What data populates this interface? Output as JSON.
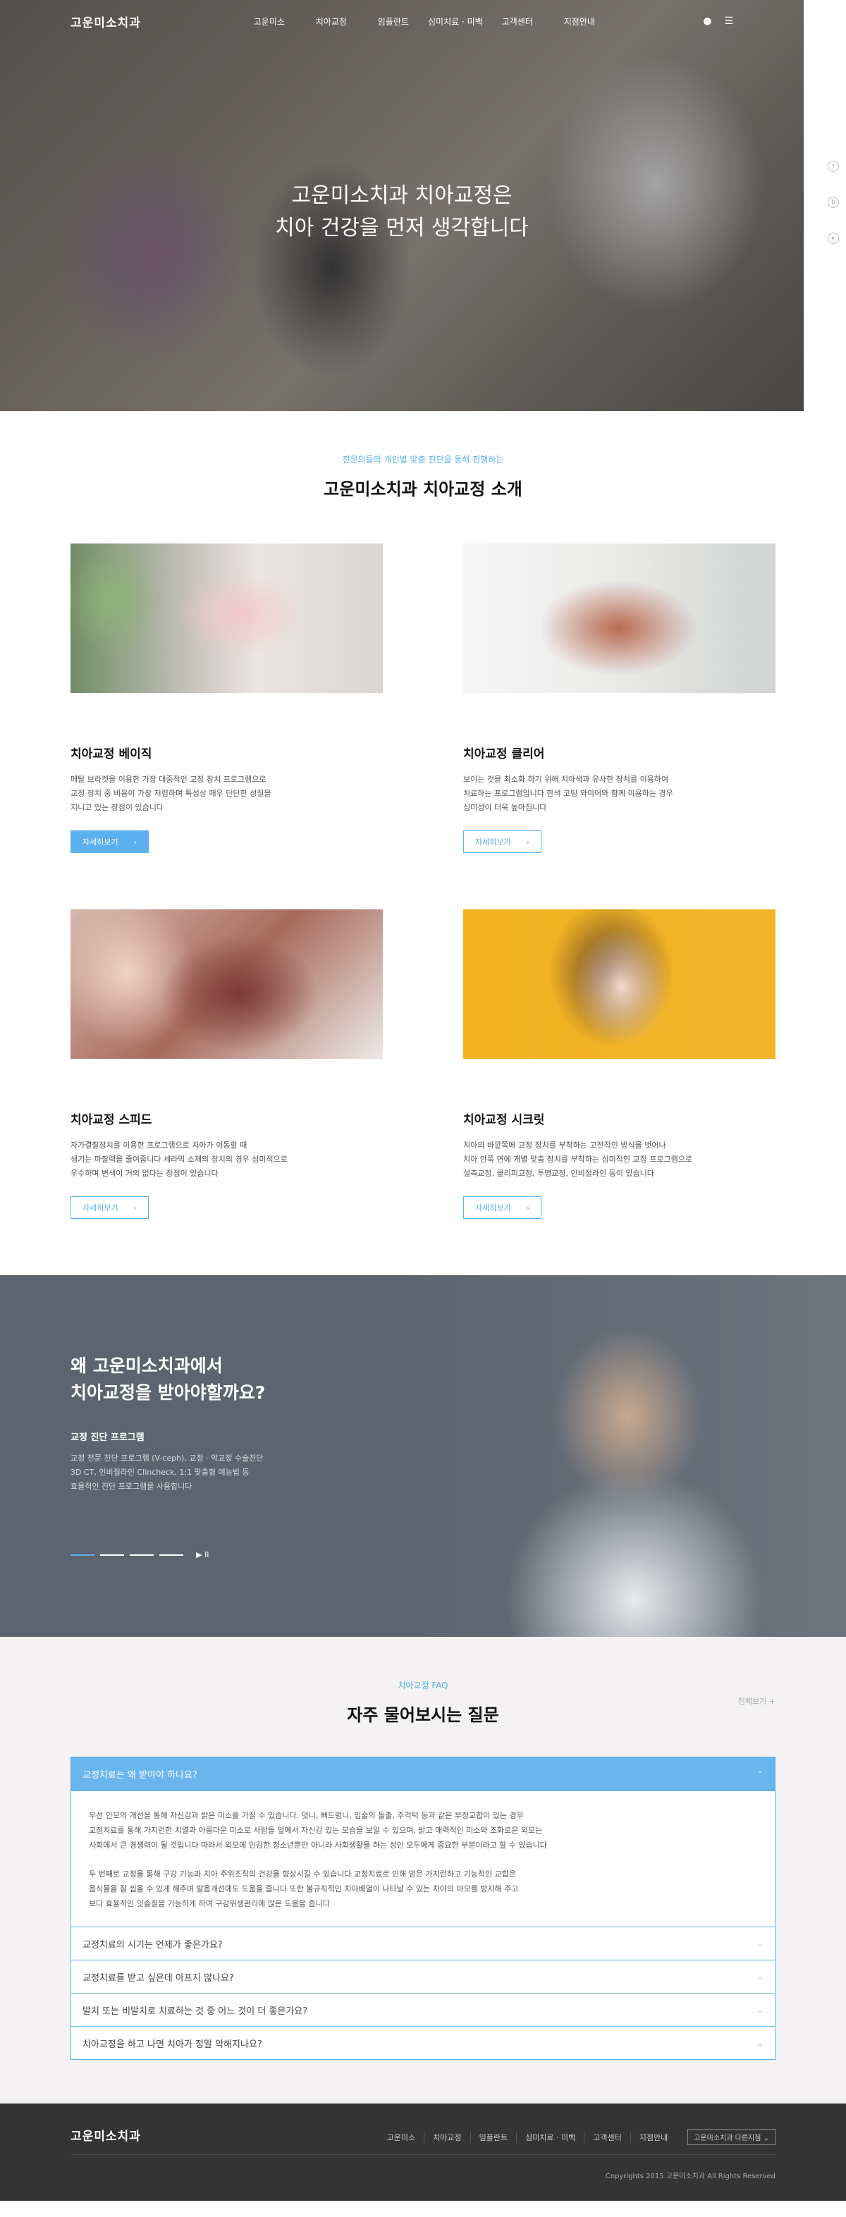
{
  "header": {
    "logo": "고운미소치과",
    "nav": [
      "고운미소",
      "치아교정",
      "임플란트",
      "심미치료 · 미백",
      "고객센터",
      "지점안내"
    ],
    "user_icon": "user-icon",
    "menu_icon": "hamburger-icon"
  },
  "hero": {
    "title_line1": "고운미소치과 치아교정은",
    "title_line2": "치아 건강을 먼저 생각합니다"
  },
  "quick_icons": [
    "kakao-icon",
    "blog-icon",
    "youtube-icon"
  ],
  "intro": {
    "subtitle": "전문의들의 개인별 맞춤 진단을 통해 진행하는",
    "title": "고운미소치과 치아교정 소개",
    "cards": [
      {
        "title": "치아교정 베이직",
        "desc": "메탈 브라켓을 이용한 가장 대중적인 교정 장치 프로그램으로\n교정 장치 중 비용이 가장 저렴하며 특성상 매우 단단한 성질을\n지니고 있는 장점이 있습니다",
        "button": "자세히보기"
      },
      {
        "title": "치아교정 클리어",
        "desc": "보이는 것을 최소화 하기 위해 치아색과 유사한 장치를 이용하여\n치료하는 프로그램입니다 한색 코팅 와이어와 함께 이용하는 경우\n심미성이 더욱 높아집니다",
        "button": "자세히보기"
      },
      {
        "title": "치아교정 스피드",
        "desc": "자가결찰장치를 이용한 프로그램으로 치아가 이동할 때\n생기는 마찰력을 줄여줍니다 세라믹 소재의 장치의 경우 심미적으로\n우수하며 변색이 거의 없다는 장점이 있습니다",
        "button": "자세히보기"
      },
      {
        "title": "치아교정 시크릿",
        "desc": "치아의 바깥쪽에 교정 장치를 부착하는 고전적인 방식을 벗어나\n치아 안쪽 면에 개별 맞춤 장치를 부착하는 심미적인 교정 프로그램으로\n설측교정, 클리피교정, 투명교정, 인비절라인 등이 있습니다",
        "button": "자세히보기"
      }
    ]
  },
  "why": {
    "title": "왜 고운미소치과에서\n치아교정을 받아야할까요?",
    "program_title": "교정 진단 프로그램",
    "program_desc": "교정 전문 진단 프로그램 (V-ceph), 교정 · 악교정 수술진단\n3D CT, 인비절라인 Clincheck, 1:1 맞춤형 예능법 등\n효율적인 진단 프로그램을 사용합니다",
    "play_controls": "▶ II"
  },
  "faq": {
    "subtitle": "치아교정 FAQ",
    "title": "자주 물어보시는 질문",
    "view_all": "전체보기 +",
    "items": [
      {
        "q": "교정치료는 왜 받아야 하나요?"
      },
      {
        "q": "교정치료의 시기는 언제가 좋은가요?"
      },
      {
        "q": "교정치료를 받고 싶은데 아프지 않나요?"
      },
      {
        "q": "발치 또는 비발치로 치료하는 것 중 어느 것이 더 좋은가요?"
      },
      {
        "q": "치아교정을 하고 나면 치아가 정말 약해지나요?"
      }
    ],
    "answer_p1": "우선 안모의 개선을 통해 자신감과 밝은 미소를 가질 수 있습니다. 덧니, 뻐드렁니, 입술의 돌출, 주걱턱 등과 같은 부정교합이 있는 경우\n교정치료를 통해 가지런한 치열과 아름다운 미소로 사람들 앞에서 자신감 있는 모습을 보일 수 있으며, 밝고 매력적인 미소와 조화로운 외모는\n사회에서 큰 경쟁력이 될 것입니다 따라서 외모에 민감한 청소년뿐만 아니라 사회생활을 하는 성인 모두에게 중요한 부분이라고 할 수 있습니다",
    "answer_p2": "두 번째로 교정을 통해 구강 기능과 치아 주위조직의 건강을 향상시킬 수 있습니다 교정치료로 인해 얻은 가지런하고 기능적인 교합은\n음식물을 잘 씹을 수 있게 해주며 발음개선에도 도움을 줍니다 또한 불규칙적인 치아배열이 나타날 수 있는 치아의 마모를 방지해 주고\n보다 효율적인 잇솔질을 가능하게 하여 구강위생관리에 많은 도움을 줍니다"
  },
  "footer": {
    "logo": "고운미소치과",
    "menu": [
      "고운미소",
      "치아교정",
      "임플란트",
      "심미치료 · 미백",
      "고객센터",
      "지점안내"
    ],
    "family": "고운미소치과 다른지점 ⌄",
    "copyright": "Copyrights 2015 고운미소치과 All Rights Reserved"
  }
}
